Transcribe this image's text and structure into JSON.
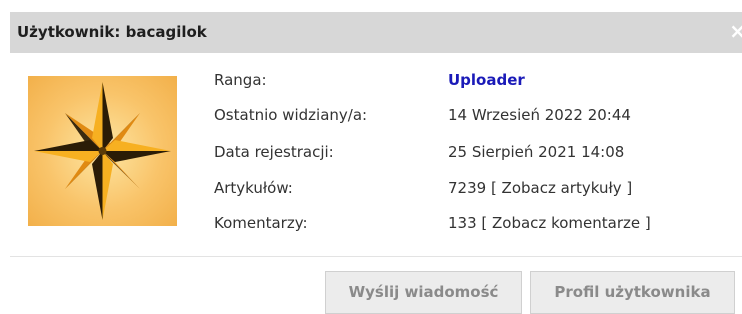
{
  "dialog": {
    "title": "Użytkownik: bacagilok",
    "close_glyph": "×"
  },
  "avatar": {
    "icon": "compass-star-icon"
  },
  "info": {
    "rows": [
      {
        "label": "Ranga:",
        "value": "Uploader"
      },
      {
        "label": "Ostatnio widziany/a:",
        "value": "14 Wrzesień 2022 20:44"
      },
      {
        "label": "Data rejestracji:",
        "value": "25 Sierpień 2021 14:08"
      },
      {
        "label": "Artykułów:",
        "value": "7239 [ Zobacz artykuły ]"
      },
      {
        "label": "Komentarzy:",
        "value": "133 [ Zobacz komentarze ]"
      }
    ]
  },
  "buttons": {
    "send_message": "Wyślij wiadomość",
    "user_profile": "Profil użytkownika"
  },
  "colors": {
    "header_bg": "#d7d7d7",
    "rank_accent": "#1a1ab8",
    "button_bg": "#ececec"
  }
}
